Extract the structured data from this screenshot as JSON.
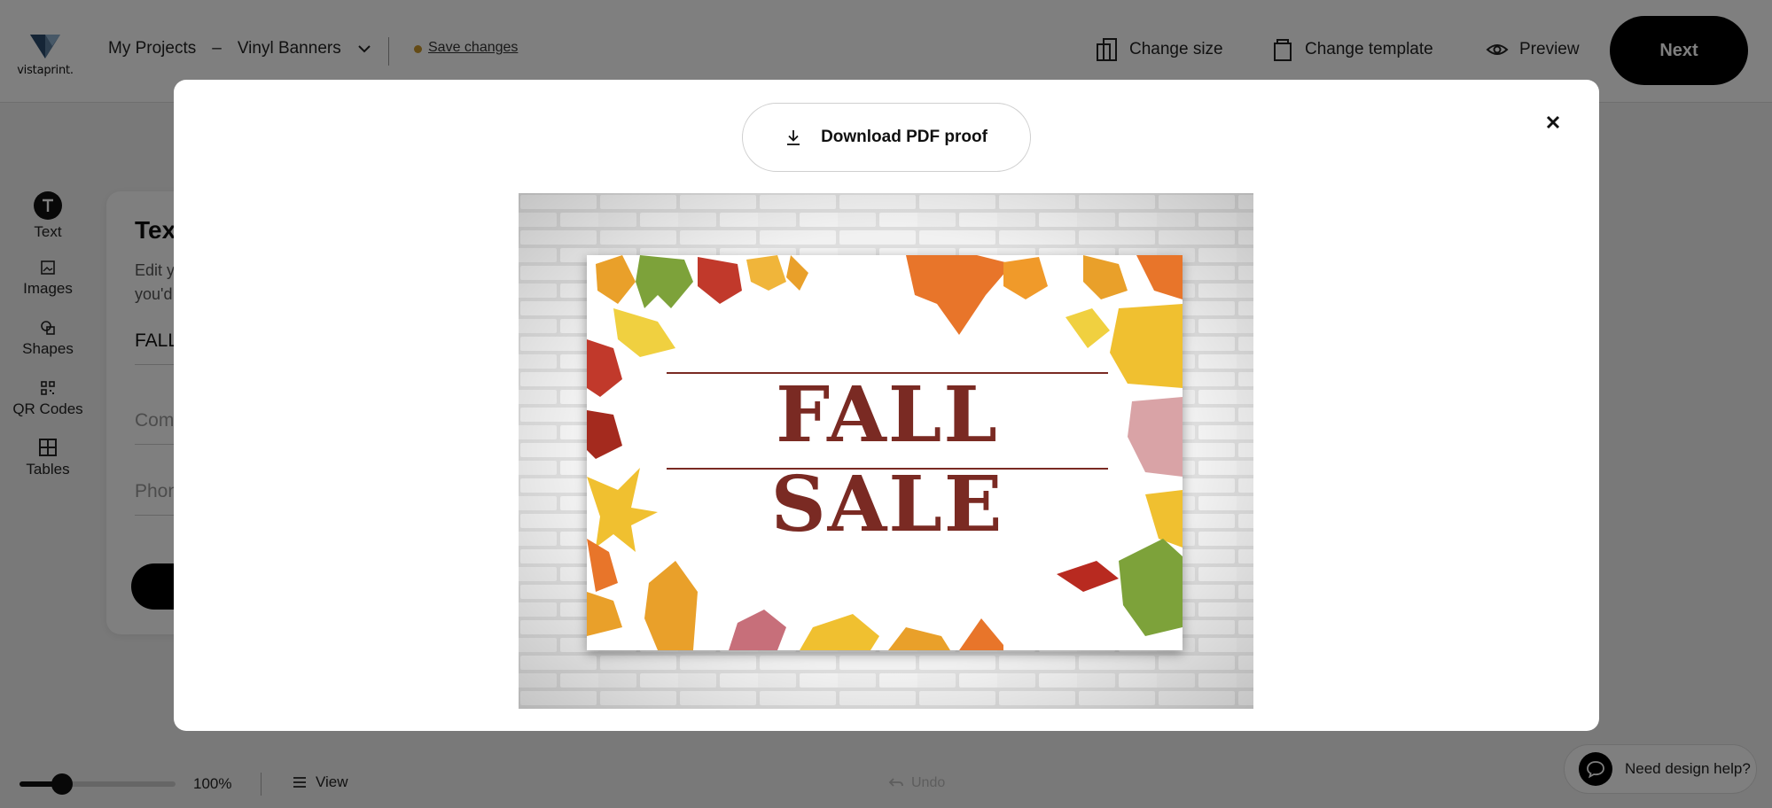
{
  "header": {
    "logo_text": "vistaprint.",
    "breadcrumb": {
      "root": "My Projects",
      "separator": "–",
      "project": "Vinyl Banners"
    },
    "save_link": "Save changes",
    "change_size": "Change size",
    "change_template": "Change template",
    "preview": "Preview",
    "next": "Next"
  },
  "rail": [
    {
      "label": "Text",
      "icon": "text-icon"
    },
    {
      "label": "Images",
      "icon": "image-icon"
    },
    {
      "label": "Shapes",
      "icon": "shapes-icon"
    },
    {
      "label": "QR Codes",
      "icon": "qr-code-icon"
    },
    {
      "label": "Tables",
      "icon": "table-icon"
    }
  ],
  "panel": {
    "title": "Text",
    "desc_line1": "Edit y",
    "desc_line2": "you'd",
    "field1_value": "FALL",
    "field2_placeholder": "Com",
    "field3_placeholder": "Phon"
  },
  "bottom": {
    "zoom_value": "100%",
    "zoom_fraction": 0.19,
    "view": "View",
    "undo": "Undo",
    "help": "Need design help?"
  },
  "modal": {
    "download": "Download PDF proof",
    "close_icon": "close-icon",
    "banner_title": "FALL SALE"
  },
  "colors": {
    "accent": "#000000",
    "banner_text": "#7a2a23",
    "save_dot": "#c9962c"
  }
}
